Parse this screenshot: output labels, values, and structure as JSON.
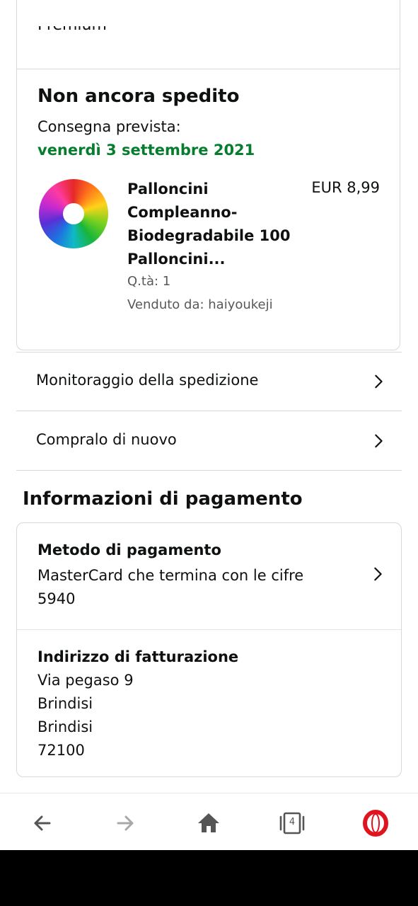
{
  "top_cut_text": "Premium",
  "shipment": {
    "status_title": "Non ancora spedito",
    "delivery_label": "Consegna prevista:",
    "delivery_date": "venerdì 3 settembre 2021",
    "product": {
      "title": "Palloncini Compleanno- Biodegradabile 100 Palloncini...",
      "price": "EUR 8,99",
      "qty": "Q.tà: 1",
      "seller": "Venduto da: haiyoukeji",
      "image_icon": "colorful-balloons-image"
    }
  },
  "actions": [
    {
      "label": "Monitoraggio della spedizione",
      "icon": "chevron-right-icon"
    },
    {
      "label": "Compralo di nuovo",
      "icon": "chevron-right-icon"
    }
  ],
  "payment": {
    "heading": "Informazioni di pagamento",
    "method_title": "Metodo di pagamento",
    "method_value": "MasterCard che termina con le cifre 5940",
    "billing_title": "Indirizzo di fatturazione",
    "billing_lines": [
      "Via pegaso 9",
      "Brindisi",
      "Brindisi",
      "72100"
    ]
  },
  "browser_bar": {
    "tab_count": "4",
    "buttons": [
      "back-arrow-icon",
      "forward-arrow-icon",
      "home-icon",
      "tabs-icon",
      "opera-logo-icon"
    ]
  },
  "colors": {
    "delivery_green": "#067d2e",
    "opera_red": "#e0141e",
    "border": "#d5d9d9"
  }
}
